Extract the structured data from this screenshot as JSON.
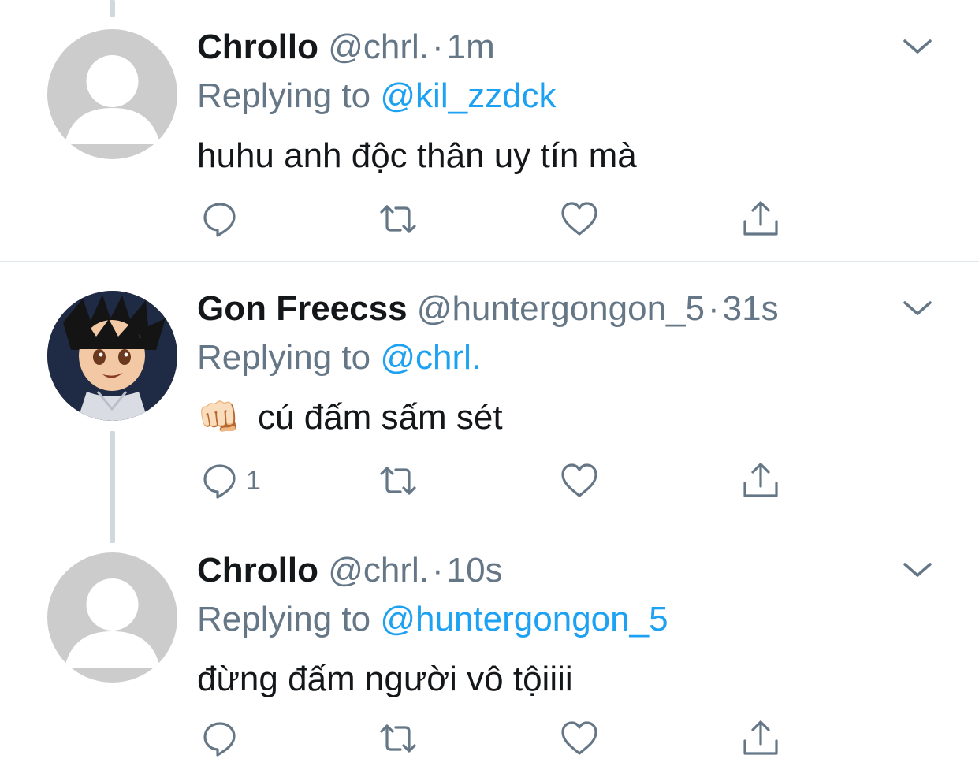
{
  "tweets": [
    {
      "name": "Chrollo",
      "handle": "@chrl.",
      "dot": "·",
      "time": "1m",
      "replying_prefix": "Replying to",
      "replying_to": "@kil_zzdck",
      "text": "huhu anh độc thân uy tín mà",
      "avatar": "default-avatar",
      "reply_count": ""
    },
    {
      "name": "Gon Freecss",
      "handle": "@huntergongon_5",
      "dot": "·",
      "time": "31s",
      "replying_prefix": "Replying to",
      "replying_to": "@chrl.",
      "emoji": "👊🏻",
      "text": "cú đấm sấm sét",
      "avatar": "anime-boy-avatar",
      "reply_count": "1"
    },
    {
      "name": "Chrollo",
      "handle": "@chrl.",
      "dot": "·",
      "time": "10s",
      "replying_prefix": "Replying to",
      "replying_to": "@huntergongon_5",
      "text": "đừng đấm người vô tộiiii",
      "avatar": "default-avatar",
      "reply_count": ""
    }
  ],
  "colors": {
    "text": "#14171a",
    "secondary": "#657786",
    "link": "#1da1f2",
    "icon": "#657786",
    "divider": "#e1e8ed",
    "thread_line": "#cfd9de"
  }
}
